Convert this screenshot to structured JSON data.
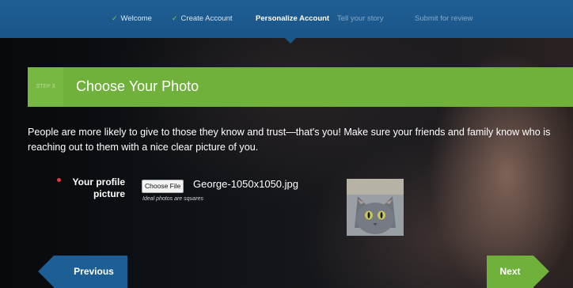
{
  "nav": {
    "steps": [
      {
        "label": "Welcome",
        "done": true
      },
      {
        "label": "Create Account",
        "done": true
      },
      {
        "label": "Personalize Account",
        "active": true
      },
      {
        "label": "Tell your story"
      },
      {
        "label": "Submit for review"
      }
    ]
  },
  "section": {
    "step_label": "STEP 3",
    "title": "Choose Your Photo"
  },
  "intro_text": "People are more likely to give to those they know and trust—that's you! Make sure your friends and family know who is reaching out to them with a nice clear picture of you.",
  "profile_picture": {
    "label": "Your profile picture",
    "choose_button": "Choose File",
    "file_name": "George-1050x1050.jpg",
    "hint": "Ideal photos are squares"
  },
  "buttons": {
    "previous": "Previous",
    "next": "Next"
  },
  "colors": {
    "nav_blue": "#1a5588",
    "accent_green": "#6fb13b",
    "required_red": "#e23b3b"
  }
}
